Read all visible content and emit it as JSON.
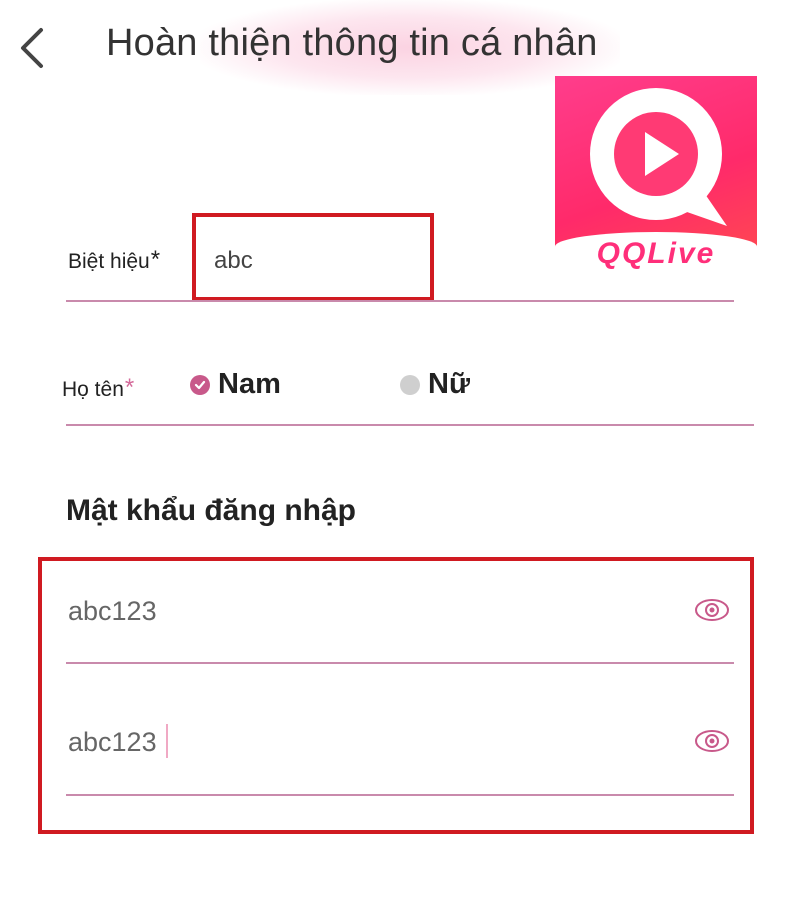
{
  "header": {
    "back_icon": "chevron-left-icon",
    "title": "Hoàn thiện thông tin cá nhân"
  },
  "logo": {
    "text": "QQLive"
  },
  "form": {
    "nickname": {
      "label": "Biệt hiệu",
      "required_mark": "*",
      "value": "abc"
    },
    "fullname": {
      "label": "Họ tên",
      "required_mark": "*",
      "options": [
        {
          "label": "Nam",
          "selected": true
        },
        {
          "label": "Nữ",
          "selected": false
        }
      ]
    },
    "password_section": {
      "title": "Mật khẩu đăng nhập",
      "password": {
        "value": "abc123",
        "icon": "eye-icon"
      },
      "confirm_password": {
        "value": "abc123",
        "icon": "eye-icon"
      }
    }
  },
  "colors": {
    "accent": "#c8598a",
    "underline": "#c98aac",
    "highlight": "#d01a21"
  }
}
